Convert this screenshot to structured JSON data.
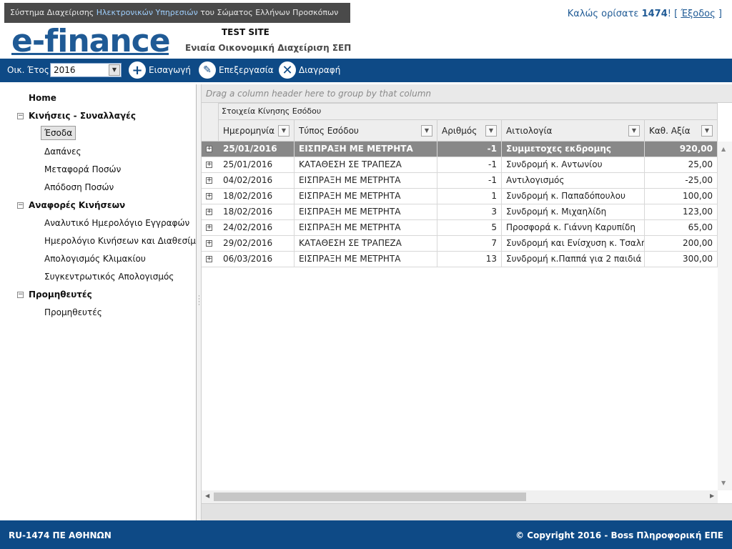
{
  "header": {
    "sys_prefix": "Σύστημα Διαχείρισης ",
    "sys_highlight": "Ηλεκτρονικών Υπηρεσιών",
    "sys_suffix": " του Σώματος Ελλήνων Προσκόπων",
    "logo": "e-finance",
    "test_site": "TEST SITE",
    "subtitle": "Ενιαία Οικονομική Διαχείριση ΣΕΠ",
    "welcome_prefix": "Καλώς ορίσατε ",
    "user": "1474",
    "welcome_mid": "! [ ",
    "logout": "Έξοδος",
    "welcome_suffix": " ]"
  },
  "toolbar": {
    "year_label": "Οικ. Έτος",
    "year_value": "2016",
    "insert": "Εισαγωγή",
    "edit": "Επεξεργασία",
    "delete": "Διαγραφή"
  },
  "nav": {
    "home": "Home",
    "group1": "Κινήσεις - Συναλλαγές",
    "g1_items": [
      "Έσοδα",
      "Δαπάνες",
      "Μεταφορά Ποσών",
      "Απόδοση Ποσών"
    ],
    "group2": "Αναφορές Κινήσεων",
    "g2_items": [
      "Αναλυτικό Ημερολόγιο Εγγραφών",
      "Ημερολόγιο Κινήσεων και Διαθεσίμων",
      "Απολογισμός Κλιμακίου",
      "Συγκεντρωτικός Απολογισμός"
    ],
    "group3": "Προμηθευτές",
    "g3_items": [
      "Προμηθευτές"
    ]
  },
  "grid": {
    "group_hint": "Drag a column header here to group by that column",
    "band": "Στοιχεία Κίνησης Εσόδου",
    "columns": [
      "Ημερομηνία",
      "Τύπος Εσόδου",
      "Αριθμός",
      "Αιτιολογία",
      "Καθ. Αξία"
    ],
    "rows": [
      {
        "date": "25/01/2016",
        "type": "ΕΙΣΠΡΑΞΗ ΜΕ ΜΕΤΡΗΤΑ",
        "num": "-1",
        "reason": "Συμμετοχες εκδρομης",
        "value": "920,00"
      },
      {
        "date": "25/01/2016",
        "type": "ΚΑΤΑΘΕΣΗ ΣΕ ΤΡΑΠΕΖΑ",
        "num": "-1",
        "reason": "Συνδρομή κ. Αντωνίου",
        "value": "25,00"
      },
      {
        "date": "04/02/2016",
        "type": "ΕΙΣΠΡΑΞΗ ΜΕ ΜΕΤΡΗΤΑ",
        "num": "-1",
        "reason": "Αντιλογισμός",
        "value": "-25,00"
      },
      {
        "date": "18/02/2016",
        "type": "ΕΙΣΠΡΑΞΗ ΜΕ ΜΕΤΡΗΤΑ",
        "num": "1",
        "reason": "Συνδρομή κ. Παπαδόπουλου",
        "value": "100,00"
      },
      {
        "date": "18/02/2016",
        "type": "ΕΙΣΠΡΑΞΗ ΜΕ ΜΕΤΡΗΤΑ",
        "num": "3",
        "reason": "Συνδρομή κ. Μιχαηλίδη",
        "value": "123,00"
      },
      {
        "date": "24/02/2016",
        "type": "ΕΙΣΠΡΑΞΗ ΜΕ ΜΕΤΡΗΤΑ",
        "num": "5",
        "reason": "Προσφορά κ. Γιάννη Καρυπίδη",
        "value": "65,00"
      },
      {
        "date": "29/02/2016",
        "type": "ΚΑΤΑΘΕΣΗ ΣΕ ΤΡΑΠΕΖΑ",
        "num": "7",
        "reason": "Συνδρομή και Ενίσχυση κ. Τσαλή",
        "value": "200,00"
      },
      {
        "date": "06/03/2016",
        "type": "ΕΙΣΠΡΑΞΗ ΜΕ ΜΕΤΡΗΤΑ",
        "num": "13",
        "reason": "Συνδρομή κ.Παππά για 2 παιδιά",
        "value": "300,00"
      }
    ]
  },
  "footer": {
    "left": "RU-1474 ΠΕ ΑΘΗΝΩΝ",
    "right": "© Copyright 2016 - Boss Πληροφορική ΕΠΕ"
  },
  "colors": {
    "brand_blue": "#0e4a86",
    "logo_blue": "#1f5a95",
    "selected_row": "#888888"
  }
}
